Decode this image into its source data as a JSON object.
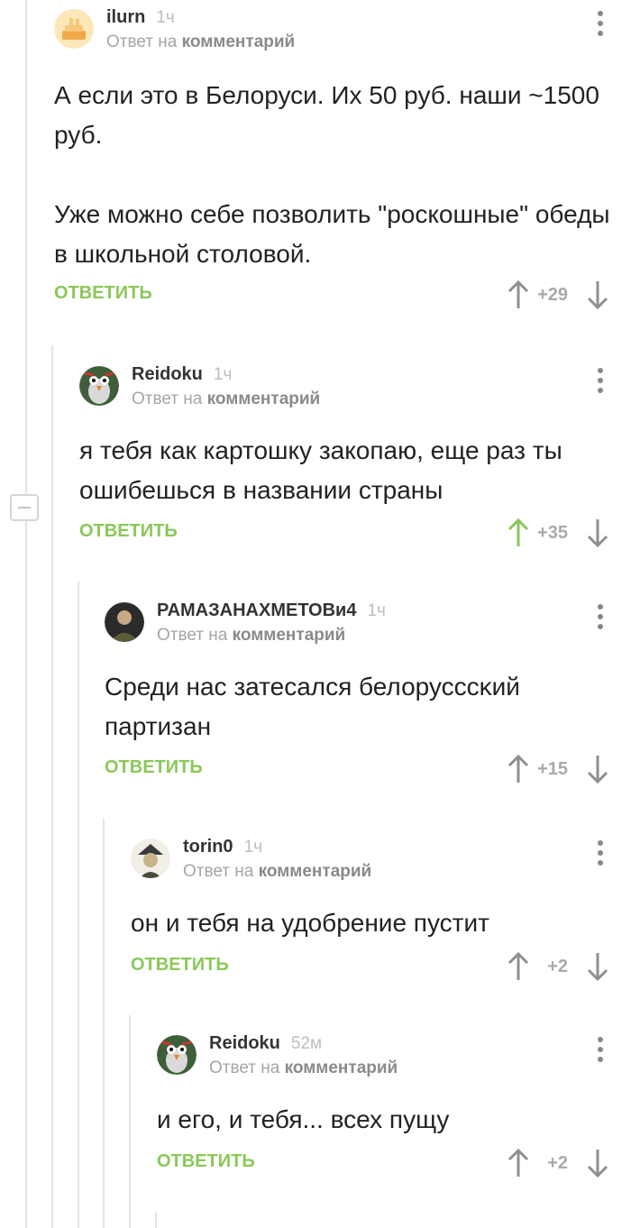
{
  "reply_to_text": "Ответ на",
  "reply_to_link": "комментарий",
  "reply_label": "ОТВЕТИТЬ",
  "colors": {
    "reply_green": "#8ac858",
    "vote_active": "#8ac858",
    "vote_default": "#8f8f8f",
    "thread_line": "#e4e4e4"
  },
  "comments": [
    {
      "author": "ilurn",
      "time": "1ч",
      "avatar_icon": "cake-avatar-icon",
      "paragraphs": [
        "А если это в Белоруси. Их 50 руб. наши ~1500 руб.",
        "Уже можно себе позволить \"роскошные\" обеды в школьной столовой."
      ],
      "rating": "+29",
      "upvoted": false
    },
    {
      "author": "Reidoku",
      "time": "1ч",
      "avatar_icon": "bird-avatar-icon",
      "paragraphs": [
        "я тебя как картошку закопаю, еще раз ты ошибешься в названии страны"
      ],
      "rating": "+35",
      "upvoted": true
    },
    {
      "author": "РАМАЗАНАХМЕТОВи4",
      "time": "1ч",
      "avatar_icon": "person-avatar-icon",
      "paragraphs": [
        "Среди нас затесался белорусссκий партизан"
      ],
      "rating": "+15",
      "upvoted": false
    },
    {
      "author": "torin0",
      "time": "1ч",
      "avatar_icon": "hat-avatar-icon",
      "paragraphs": [
        "он и тебя на удобрение пустит"
      ],
      "rating": "+2",
      "upvoted": false
    },
    {
      "author": "Reidoku",
      "time": "52м",
      "avatar_icon": "bird-avatar-icon",
      "paragraphs": [
        "и его, и тебя... всех пущу"
      ],
      "rating": "+2",
      "upvoted": false
    }
  ]
}
